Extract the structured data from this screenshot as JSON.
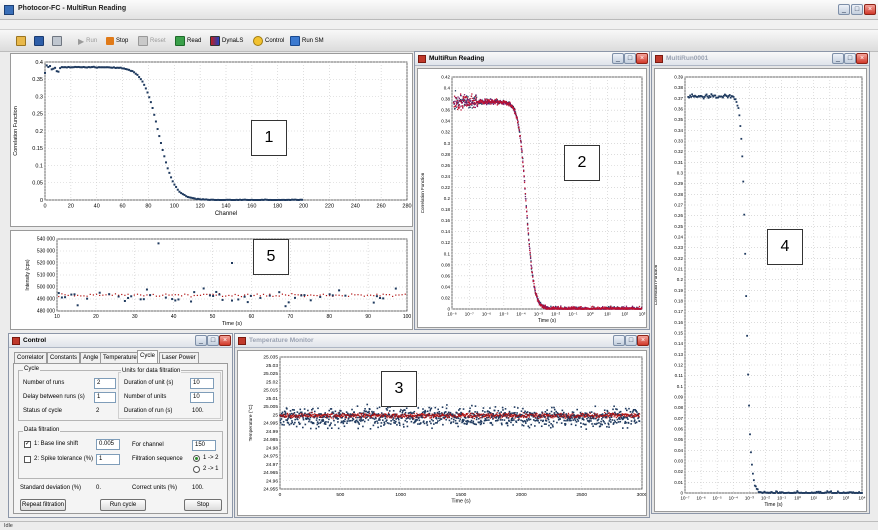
{
  "app": {
    "title": "Photocor-FC - MultiRun Reading"
  },
  "toolbar": {
    "run": "Run",
    "stop": "Stop",
    "reset": "Reset",
    "read": "Read",
    "dynals": "DynaLS",
    "control": "Control",
    "run_sm": "Run SM"
  },
  "panel1": {
    "label": "1",
    "xlabel": "Channel",
    "ylabel": "Correlation Function",
    "xticks": [
      "0",
      "20",
      "40",
      "60",
      "80",
      "100",
      "120",
      "140",
      "160",
      "180",
      "200",
      "220",
      "240",
      "260",
      "280"
    ],
    "yticks": [
      "0",
      "0.05",
      "0.1",
      "0.15",
      "0.2",
      "0.25",
      "0.3",
      "0.35",
      "0.4"
    ]
  },
  "panel5": {
    "label": "5",
    "xlabel": "Time  (s)",
    "ylabel": "Intensity (cps)",
    "xticks": [
      "10",
      "20",
      "30",
      "40",
      "50",
      "60",
      "70",
      "80",
      "90",
      "100"
    ],
    "yticks": [
      "540 000",
      "530 000",
      "520 000",
      "510 000",
      "500 000",
      "490 000",
      "480 000"
    ]
  },
  "multirun": {
    "title": "MultiRun Reading",
    "label": "2",
    "xlabel": "Time  (s)",
    "ylabel": "Correlation Function",
    "yticks": [
      "0.42",
      "0.4",
      "0.38",
      "0.36",
      "0.34",
      "0.32",
      "0.3",
      "0.28",
      "0.26",
      "0.24",
      "0.22",
      "0.2",
      "0.18",
      "0.16",
      "0.14",
      "0.12",
      "0.1",
      "0.08",
      "0.06",
      "0.04",
      "0.02",
      "0"
    ],
    "xticks": [
      "10⁻⁸",
      "10⁻⁷",
      "10⁻⁶",
      "10⁻⁵",
      "10⁻⁴",
      "10⁻³",
      "10⁻²",
      "10⁻¹",
      "10⁰",
      "10¹",
      "10²",
      "10³"
    ]
  },
  "multirun0001": {
    "title": "MultiRun0001",
    "label": "4",
    "xlabel": "Time  (s)",
    "ylabel": "Correlation Function",
    "yticks": [
      "0.39",
      "0.38",
      "0.37",
      "0.36",
      "0.35",
      "0.34",
      "0.33",
      "0.32",
      "0.31",
      "0.3",
      "0.29",
      "0.28",
      "0.27",
      "0.26",
      "0.25",
      "0.24",
      "0.23",
      "0.22",
      "0.21",
      "0.2",
      "0.19",
      "0.18",
      "0.17",
      "0.16",
      "0.15",
      "0.14",
      "0.13",
      "0.12",
      "0.11",
      "0.1",
      "0.09",
      "0.08",
      "0.07",
      "0.06",
      "0.05",
      "0.04",
      "0.03",
      "0.02",
      "0.01",
      "0"
    ],
    "xticks": [
      "10⁻⁷",
      "10⁻⁶",
      "10⁻⁵",
      "10⁻⁴",
      "10⁻³",
      "10⁻²",
      "10⁻¹",
      "10⁰",
      "10¹",
      "10²",
      "10³",
      "10⁴"
    ]
  },
  "temperature": {
    "title": "Temperature Monitor",
    "label": "3",
    "xlabel": "Time  (s)",
    "ylabel": "Temperature (°C)",
    "yticks": [
      "25.035",
      "25.03",
      "25.025",
      "25.02",
      "25.015",
      "25.01",
      "25.005",
      "25",
      "24.995",
      "24.99",
      "24.985",
      "24.98",
      "24.975",
      "24.97",
      "24.965",
      "24.96",
      "24.955"
    ],
    "xticks": [
      "0",
      "500",
      "1000",
      "1500",
      "2000",
      "2500",
      "3000"
    ]
  },
  "control": {
    "title": "Control",
    "tabs": [
      "Correlator",
      "Constants",
      "Angle",
      "Temperature",
      "Cycle",
      "Laser Power"
    ],
    "cycle_group": "Cycle",
    "units_group": "Units for data filtration",
    "number_of_runs_label": "Number of runs",
    "number_of_runs": "2",
    "delay_label": "Delay between runs (s)",
    "delay": "1",
    "status_label": "Status of cycle",
    "status": "2",
    "duration_unit_label": "Duration of unit (s)",
    "duration_unit": "10",
    "number_units_label": "Number of units",
    "number_units": "10",
    "duration_run_label": "Duration of run (s)",
    "duration_run": "100.",
    "filtration_group": "Data filtration",
    "baseline_label": "1: Base line shift",
    "baseline": "0.005",
    "spike_label": "2: Spike tolerance (%)",
    "spike": "1",
    "for_channel_label": "For channel",
    "for_channel": "150",
    "sequence_label": "Filtration sequence",
    "seq1": "1 -> 2",
    "seq2": "2 -> 1",
    "std_label": "Standard deviation (%)",
    "std": "0.",
    "correct_label": "Correct units (%)",
    "correct": "100.",
    "repeat_btn": "Repeat filtration",
    "runcycle_btn": "Run cycle",
    "stop_btn": "Stop"
  },
  "status": {
    "left": "Idle",
    "right": ""
  },
  "colors": {
    "data": "#1f3a5f",
    "mean": "#b01010",
    "accent": "#3a6fb8"
  }
}
